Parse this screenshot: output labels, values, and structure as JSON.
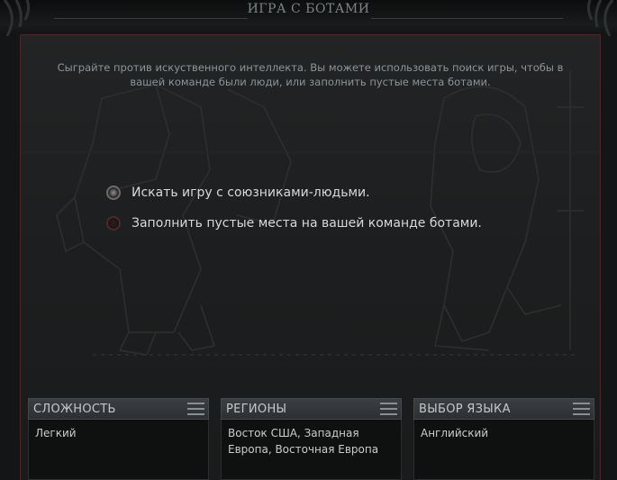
{
  "window": {
    "title": "ИГРА С БОТАМИ"
  },
  "description": "Сыграйте против искуственного интеллекта. Вы можете использовать поиск игры, чтобы в вашей команде были люди, или заполнить пустые места ботами.",
  "options": [
    {
      "label": "Искать игру с союзниками-людьми.",
      "selected": true
    },
    {
      "label": "Заполнить пустые места на вашей команде ботами.",
      "selected": false
    }
  ],
  "panels": {
    "difficulty": {
      "title": "СЛОЖНОСТЬ",
      "value": "Легкий"
    },
    "regions": {
      "title": "РЕГИОНЫ",
      "value": "Восток США, Западная Европа, Восточная Европа"
    },
    "language": {
      "title": "ВЫБОР ЯЗЫКА",
      "value": "Английский"
    }
  },
  "icons": {
    "panel_menu": "hamburger-menu-icon",
    "ornament": "thorn-ornament-icon"
  },
  "colors": {
    "accent_border": "#4a2628",
    "background": "#141516",
    "panel_header": "#3b3f42"
  }
}
